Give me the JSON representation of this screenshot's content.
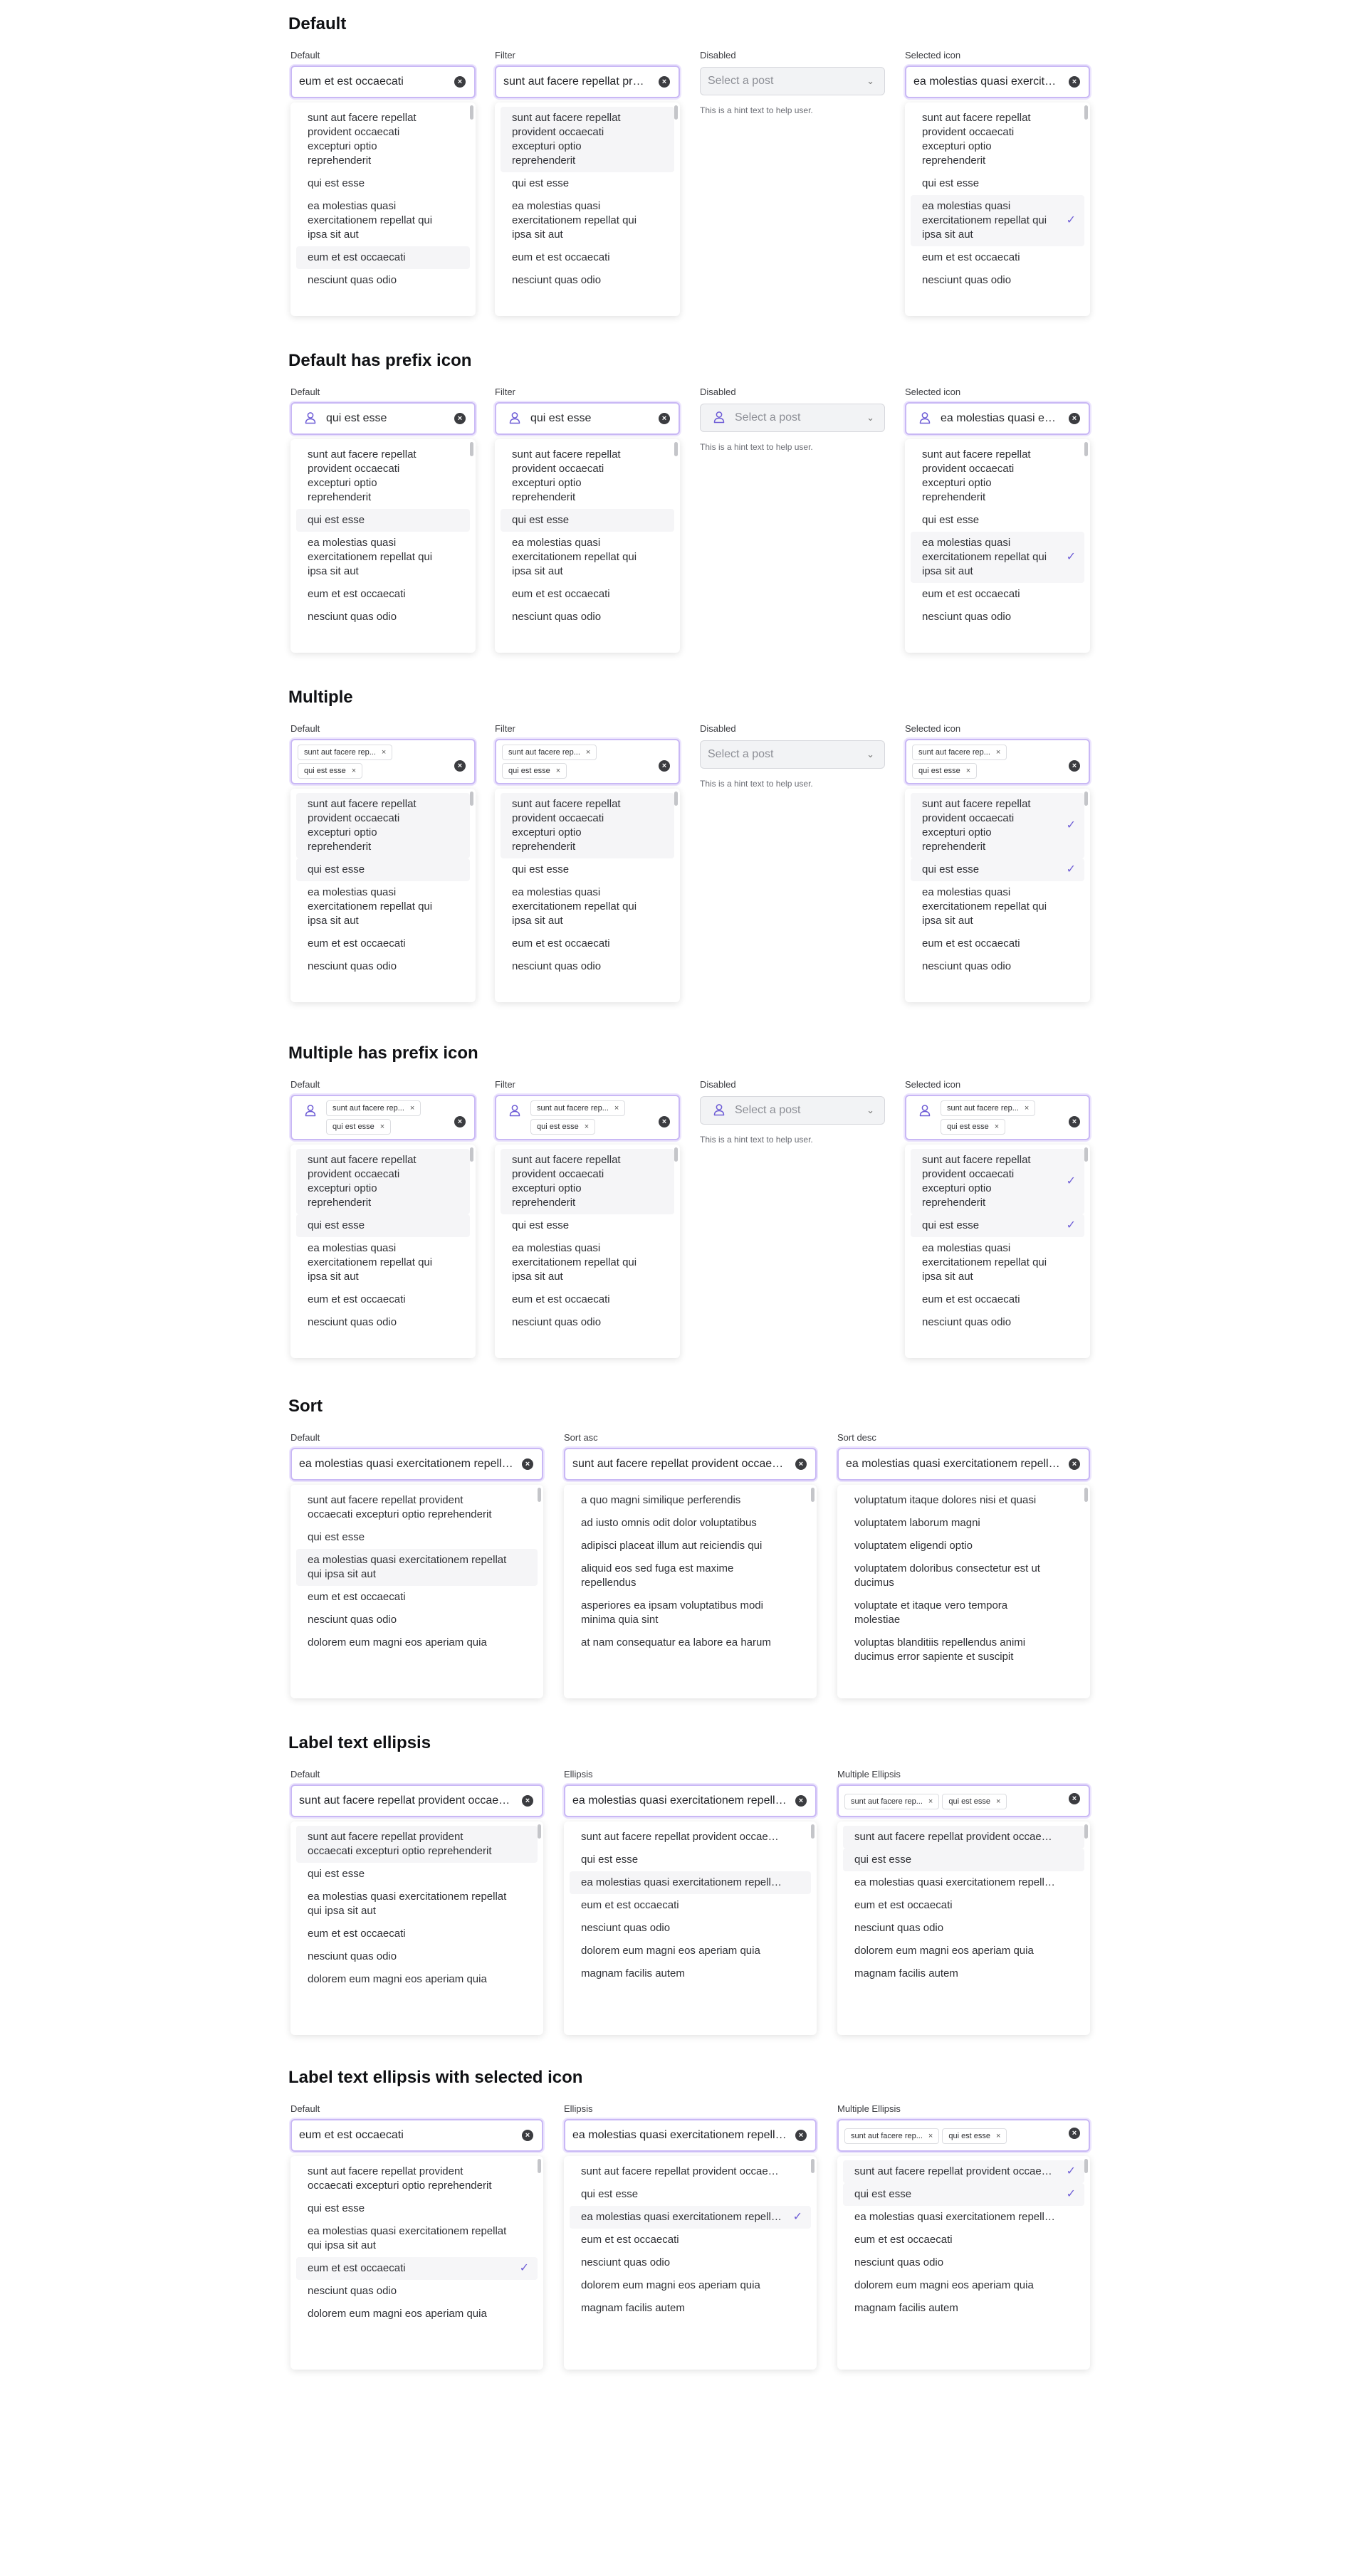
{
  "hint": "This is a hint text to help user.",
  "placeholder": "Select a post",
  "clear_icon": "×",
  "check_icon": "✓",
  "tag_remove": "×",
  "sections": [
    {
      "title": "Default"
    },
    {
      "title": "Default has prefix icon"
    },
    {
      "title": "Multiple"
    },
    {
      "title": "Multiple has prefix icon"
    },
    {
      "title": "Sort"
    },
    {
      "title": "Label text ellipsis"
    },
    {
      "title": "Label text ellipsis with selected icon"
    }
  ],
  "options": {
    "o1": "sunt aut facere repellat provident occaecati excepturi optio reprehenderit",
    "o2": "qui est esse",
    "o3": "ea molestias quasi exercitationem repellat qui ipsa sit aut",
    "o4": "eum et est occaecati",
    "o5": "nesciunt quas odio",
    "o6": "dolorem eum magni eos aperiam quia",
    "o7": "magnam facilis autem"
  },
  "sort_asc": [
    "a quo magni similique perferendis",
    "ad iusto omnis odit dolor voluptatibus",
    "adipisci placeat illum aut reiciendis qui",
    "aliquid eos sed fuga est maxime repellendus",
    "asperiores ea ipsam voluptatibus modi minima quia sint",
    "at nam consequatur ea labore ea harum"
  ],
  "sort_desc": [
    "voluptatum itaque dolores nisi et quasi",
    "voluptatem laborum magni",
    "voluptatem eligendi optio",
    "voluptatem doloribus consectetur est ut ducimus",
    "voluptate et itaque vero tempora molestiae",
    "voluptas blanditiis repellendus animi ducimus error sapiente et suscipit"
  ],
  "values": {
    "v_eum": "eum et est occaecati",
    "v_sunt": "sunt aut facere repellat provident occaecati excepturi optio reprehenderit",
    "v_ea": "ea molestias quasi exercitationem repellat qui ipsa sit aut",
    "v_qui": "qui est esse",
    "tag_sunt": "sunt aut facere rep...",
    "tag_qui": "qui est esse"
  },
  "labels": {
    "default": "Default",
    "filter": "Filter",
    "disabled": "Disabled",
    "selected_icon": "Selected icon",
    "sort_asc": "Sort asc",
    "sort_desc": "Sort desc",
    "ellipsis": "Ellipsis",
    "multiple_ellipsis": "Multiple Ellipsis"
  },
  "colors": {
    "focus_border": "#c9b8f5",
    "check": "#6e5dd6"
  }
}
